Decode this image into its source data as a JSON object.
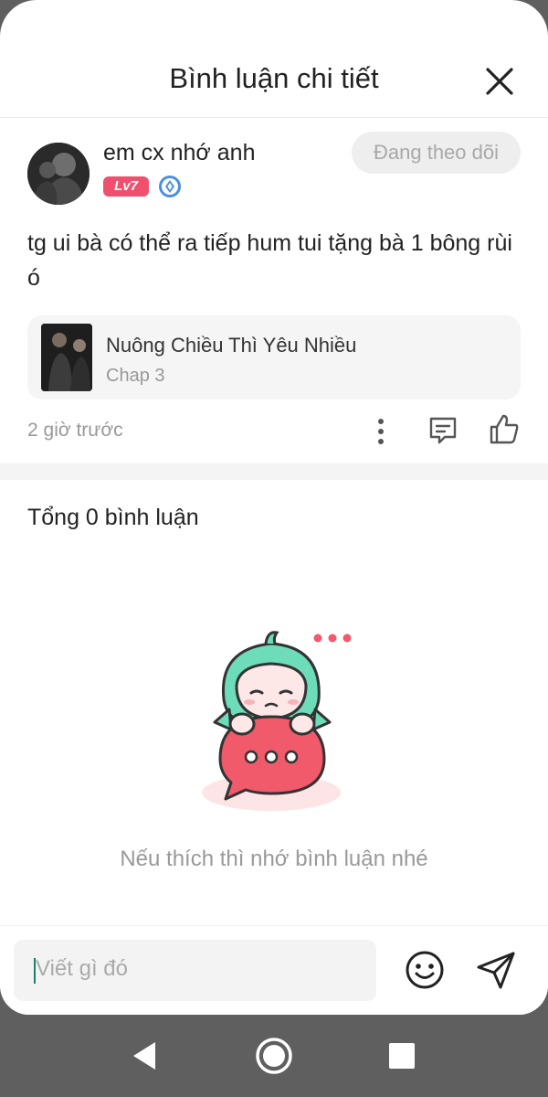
{
  "header": {
    "title": "Bình luận chi tiết"
  },
  "comment": {
    "username": "em cx nhớ anh",
    "level": "Lv7",
    "follow_label": "Đang theo dõi",
    "text": "tg ui bà có thể ra tiếp hum tui tặng bà 1 bông rùi ó",
    "manga": {
      "title": "Nuông Chiều Thì Yêu Nhiều",
      "chapter": "Chap 3"
    },
    "time": "2 giờ trước"
  },
  "comments_section": {
    "total_label": "Tổng 0 bình luận",
    "empty_message": "Nếu thích thì nhớ bình luận nhé"
  },
  "input_bar": {
    "placeholder": "Viết gì đó"
  },
  "colors": {
    "level_badge": "#f0506e",
    "illustration_hair": "#6ddcb8",
    "illustration_bubble": "#f15a6a"
  },
  "icons": [
    "close-icon",
    "vip-diamond-icon",
    "more-vertical-icon",
    "reply-icon",
    "like-icon",
    "emoji-icon",
    "send-icon",
    "back-icon",
    "home-icon",
    "recents-icon"
  ]
}
